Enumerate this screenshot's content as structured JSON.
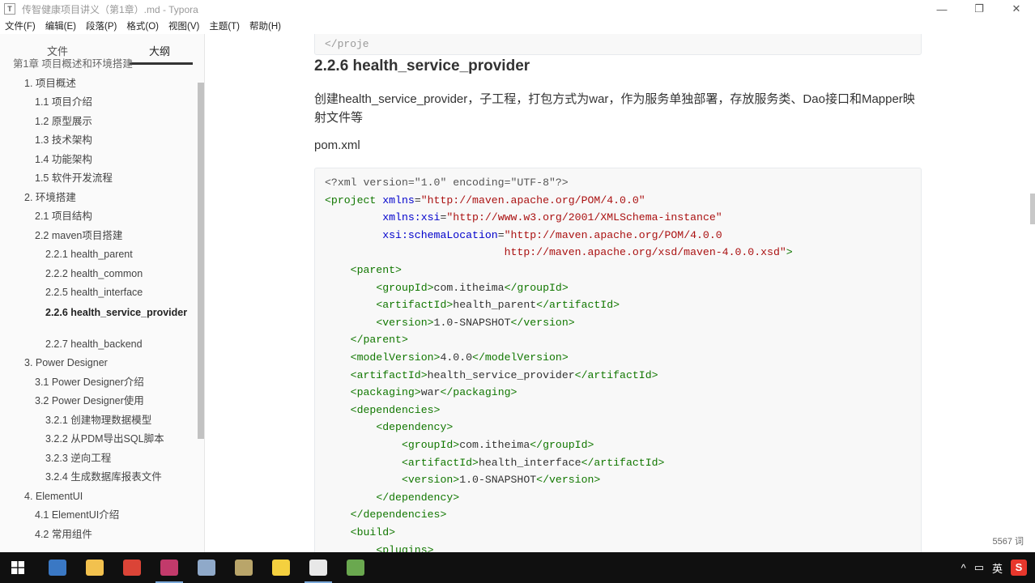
{
  "window": {
    "app_icon": "T",
    "title": "传智健康项目讲义（第1章）.md - Typora",
    "controls": {
      "minimize": "—",
      "maximize": "❐",
      "close": "✕"
    }
  },
  "menu": [
    "文件(F)",
    "编辑(E)",
    "段落(P)",
    "格式(O)",
    "视图(V)",
    "主题(T)",
    "帮助(H)"
  ],
  "sidebar": {
    "tabs": [
      "文件",
      "大纲"
    ],
    "active_tab": "大纲",
    "outline": [
      {
        "label": "第1章 项目概述和环境搭建",
        "level": 0
      },
      {
        "label": "1. 项目概述",
        "level": 1
      },
      {
        "label": "1.1 项目介绍",
        "level": 2
      },
      {
        "label": "1.2 原型展示",
        "level": 2
      },
      {
        "label": "1.3 技术架构",
        "level": 2
      },
      {
        "label": "1.4 功能架构",
        "level": 2
      },
      {
        "label": "1.5 软件开发流程",
        "level": 2
      },
      {
        "label": "2. 环境搭建",
        "level": 1
      },
      {
        "label": "2.1 项目结构",
        "level": 2
      },
      {
        "label": "2.2 maven项目搭建",
        "level": 2
      },
      {
        "label": "2.2.1 health_parent",
        "level": 3
      },
      {
        "label": "2.2.2 health_common",
        "level": 3
      },
      {
        "label": "2.2.5 health_interface",
        "level": 3
      },
      {
        "label": "2.2.6 health_service_provider",
        "level": 3,
        "active": true
      },
      {
        "label": "2.2.7 health_backend",
        "level": 3
      },
      {
        "label": "3. Power Designer",
        "level": 1
      },
      {
        "label": "3.1 Power Designer介绍",
        "level": 2
      },
      {
        "label": "3.2 Power Designer使用",
        "level": 2
      },
      {
        "label": "3.2.1 创建物理数据模型",
        "level": 3
      },
      {
        "label": "3.2.2 从PDM导出SQL脚本",
        "level": 3
      },
      {
        "label": "3.2.3 逆向工程",
        "level": 3
      },
      {
        "label": "3.2.4 生成数据库报表文件",
        "level": 3
      },
      {
        "label": "4. ElementUI",
        "level": 1
      },
      {
        "label": "4.1 ElementUI介绍",
        "level": 2
      },
      {
        "label": "4.2 常用组件",
        "level": 2
      }
    ],
    "bottom_icons": [
      "chevron-left-icon",
      "code-icon"
    ],
    "bottom_glyphs": [
      "‹",
      "</>"
    ]
  },
  "content": {
    "prev_code_tail": "</proje",
    "heading": "2.2.6 health_service_provider",
    "paragraph": "创建health_service_provider，子工程，打包方式为war，作为服务单独部署，存放服务类、Dao接口和Mapper映射文件等",
    "pom_label": "pom.xml",
    "code_lines": [
      [
        [
          "meta",
          "<?xml version=\"1.0\" encoding=\"UTF-8\"?>"
        ]
      ],
      [
        [
          "tag",
          "<project "
        ],
        [
          "attr",
          "xmlns"
        ],
        [
          "txt",
          "="
        ],
        [
          "str",
          "\"http://maven.apache.org/POM/4.0.0\""
        ]
      ],
      [
        [
          "txt",
          "         "
        ],
        [
          "attr",
          "xmlns:xsi"
        ],
        [
          "txt",
          "="
        ],
        [
          "str",
          "\"http://www.w3.org/2001/XMLSchema-instance\""
        ]
      ],
      [
        [
          "txt",
          "         "
        ],
        [
          "attr",
          "xsi:schemaLocation"
        ],
        [
          "txt",
          "="
        ],
        [
          "str",
          "\"http://maven.apache.org/POM/4.0.0"
        ]
      ],
      [
        [
          "str",
          "                            http://maven.apache.org/xsd/maven-4.0.0.xsd\""
        ],
        [
          "tag",
          ">"
        ]
      ],
      [
        [
          "txt",
          "    "
        ],
        [
          "tag",
          "<parent>"
        ]
      ],
      [
        [
          "txt",
          "        "
        ],
        [
          "tag",
          "<groupId>"
        ],
        [
          "txt",
          "com.itheima"
        ],
        [
          "tag",
          "</groupId>"
        ]
      ],
      [
        [
          "txt",
          "        "
        ],
        [
          "tag",
          "<artifactId>"
        ],
        [
          "txt",
          "health_parent"
        ],
        [
          "tag",
          "</artifactId>"
        ]
      ],
      [
        [
          "txt",
          "        "
        ],
        [
          "tag",
          "<version>"
        ],
        [
          "txt",
          "1.0-SNAPSHOT"
        ],
        [
          "tag",
          "</version>"
        ]
      ],
      [
        [
          "txt",
          "    "
        ],
        [
          "tag",
          "</parent>"
        ]
      ],
      [
        [
          "txt",
          "    "
        ],
        [
          "tag",
          "<modelVersion>"
        ],
        [
          "txt",
          "4.0.0"
        ],
        [
          "tag",
          "</modelVersion>"
        ]
      ],
      [
        [
          "txt",
          "    "
        ],
        [
          "tag",
          "<artifactId>"
        ],
        [
          "txt",
          "health_service_provider"
        ],
        [
          "tag",
          "</artifactId>"
        ]
      ],
      [
        [
          "txt",
          "    "
        ],
        [
          "tag",
          "<packaging>"
        ],
        [
          "txt",
          "war"
        ],
        [
          "tag",
          "</packaging>"
        ]
      ],
      [
        [
          "txt",
          "    "
        ],
        [
          "tag",
          "<dependencies>"
        ]
      ],
      [
        [
          "txt",
          "        "
        ],
        [
          "tag",
          "<dependency>"
        ]
      ],
      [
        [
          "txt",
          "            "
        ],
        [
          "tag",
          "<groupId>"
        ],
        [
          "txt",
          "com.itheima"
        ],
        [
          "tag",
          "</groupId>"
        ]
      ],
      [
        [
          "txt",
          "            "
        ],
        [
          "tag",
          "<artifactId>"
        ],
        [
          "txt",
          "health_interface"
        ],
        [
          "tag",
          "</artifactId>"
        ]
      ],
      [
        [
          "txt",
          "            "
        ],
        [
          "tag",
          "<version>"
        ],
        [
          "txt",
          "1.0-SNAPSHOT"
        ],
        [
          "tag",
          "</version>"
        ]
      ],
      [
        [
          "txt",
          "        "
        ],
        [
          "tag",
          "</dependency>"
        ]
      ],
      [
        [
          "txt",
          "    "
        ],
        [
          "tag",
          "</dependencies>"
        ]
      ],
      [
        [
          "txt",
          "    "
        ],
        [
          "tag",
          "<build>"
        ]
      ],
      [
        [
          "txt",
          "        "
        ],
        [
          "tag",
          "<plugins>"
        ]
      ]
    ],
    "word_count": "5567 词"
  },
  "taskbar": {
    "apps": [
      {
        "name": "people-icon",
        "color": "#3a78c4",
        "open": false
      },
      {
        "name": "file-explorer-icon",
        "color": "#f2c14e",
        "open": false
      },
      {
        "name": "chrome-icon",
        "color": "#db4437",
        "open": false
      },
      {
        "name": "intellij-idea-icon",
        "color": "#c23a6b",
        "open": true
      },
      {
        "name": "paint-icon",
        "color": "#8fa9c9",
        "open": false
      },
      {
        "name": "app-window-icon",
        "color": "#b9a56a",
        "open": false
      },
      {
        "name": "sticky-app-icon",
        "color": "#f4d03f",
        "open": false
      },
      {
        "name": "typora-icon",
        "color": "#e8e8e8",
        "open": true
      },
      {
        "name": "notepad-icon",
        "color": "#6aa84f",
        "open": false
      }
    ],
    "tray": {
      "chevron": "^",
      "ime_icon": "▭",
      "ime": "英",
      "sogou": "S"
    }
  }
}
